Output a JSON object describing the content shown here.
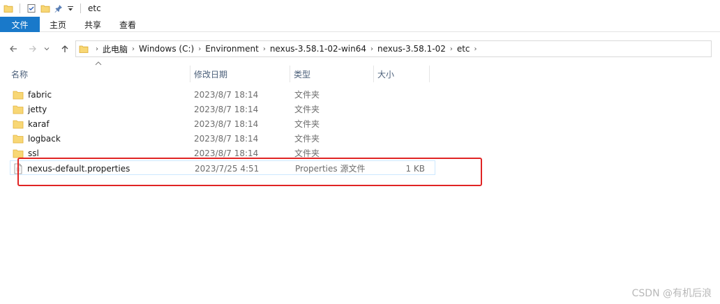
{
  "window": {
    "title": "etc"
  },
  "ribbon": {
    "tabs": [
      "文件",
      "主页",
      "共享",
      "查看"
    ]
  },
  "breadcrumb": [
    "此电脑",
    "Windows (C:)",
    "Environment",
    "nexus-3.58.1-02-win64",
    "nexus-3.58.1-02",
    "etc"
  ],
  "columns": {
    "name": "名称",
    "modified": "修改日期",
    "type": "类型",
    "size": "大小"
  },
  "rows": [
    {
      "name": "fabric",
      "modified": "2023/8/7 18:14",
      "type": "文件夹",
      "size": "",
      "icon": "folder-icon"
    },
    {
      "name": "jetty",
      "modified": "2023/8/7 18:14",
      "type": "文件夹",
      "size": "",
      "icon": "folder-icon"
    },
    {
      "name": "karaf",
      "modified": "2023/8/7 18:14",
      "type": "文件夹",
      "size": "",
      "icon": "folder-icon"
    },
    {
      "name": "logback",
      "modified": "2023/8/7 18:14",
      "type": "文件夹",
      "size": "",
      "icon": "folder-icon"
    },
    {
      "name": "ssl",
      "modified": "2023/8/7 18:14",
      "type": "文件夹",
      "size": "",
      "icon": "folder-icon"
    },
    {
      "name": "nexus-default.properties",
      "modified": "2023/7/25 4:51",
      "type": "Properties 源文件",
      "size": "1 KB",
      "icon": "file-icon"
    }
  ],
  "watermark": "CSDN @有机后浪",
  "colors": {
    "accent": "#1979ca",
    "highlight": "#e02424",
    "folder": "#f8d775"
  }
}
